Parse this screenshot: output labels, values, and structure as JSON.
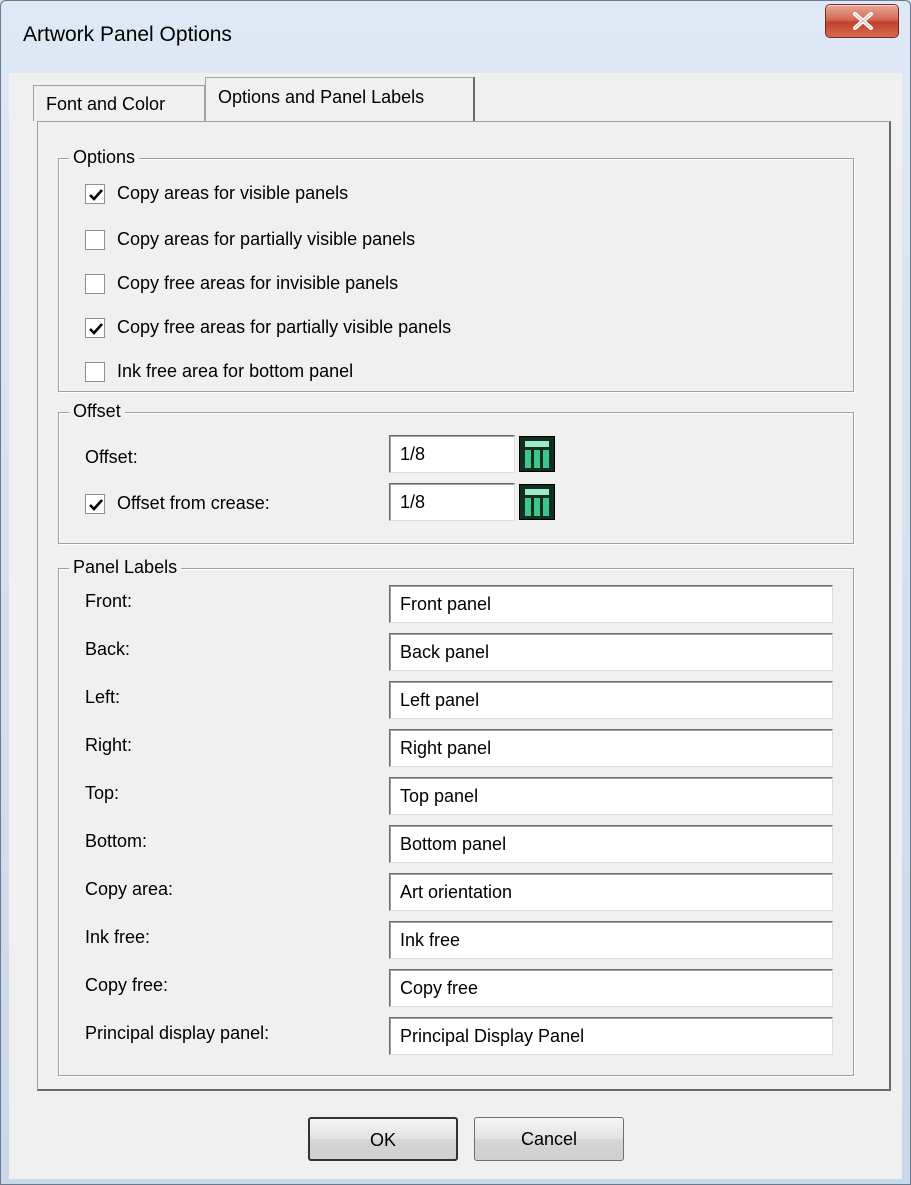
{
  "window": {
    "title": "Artwork Panel Options"
  },
  "tabs": [
    {
      "label": "Font and Color"
    },
    {
      "label": "Options and Panel Labels"
    }
  ],
  "options_group": {
    "title": "Options",
    "items": [
      {
        "label": "Copy areas for visible panels",
        "checked": true
      },
      {
        "label": "Copy areas for partially visible panels",
        "checked": false
      },
      {
        "label": "Copy free areas for invisible panels",
        "checked": false
      },
      {
        "label": "Copy free areas for partially visible panels",
        "checked": true
      },
      {
        "label": "Ink free area for bottom panel",
        "checked": false
      }
    ]
  },
  "offset_group": {
    "title": "Offset",
    "offset_label": "Offset:",
    "offset_value": "1/8",
    "crease_label": "Offset from crease:",
    "crease_checked": true,
    "crease_value": "1/8"
  },
  "labels_group": {
    "title": "Panel Labels",
    "rows": [
      {
        "label": "Front:",
        "value": "Front panel"
      },
      {
        "label": "Back:",
        "value": "Back panel"
      },
      {
        "label": "Left:",
        "value": "Left panel"
      },
      {
        "label": "Right:",
        "value": "Right panel"
      },
      {
        "label": "Top:",
        "value": "Top panel"
      },
      {
        "label": "Bottom:",
        "value": "Bottom panel"
      },
      {
        "label": "Copy area:",
        "value": "Art orientation"
      },
      {
        "label": "Ink free:",
        "value": "Ink free"
      },
      {
        "label": "Copy free:",
        "value": "Copy free"
      },
      {
        "label": "Principal display panel:",
        "value": "Principal Display Panel"
      }
    ]
  },
  "buttons": {
    "ok": "OK",
    "cancel": "Cancel"
  },
  "icons": {
    "close": "close-icon",
    "checkmark": "checkmark-icon",
    "calculator": "calculator-icon"
  }
}
